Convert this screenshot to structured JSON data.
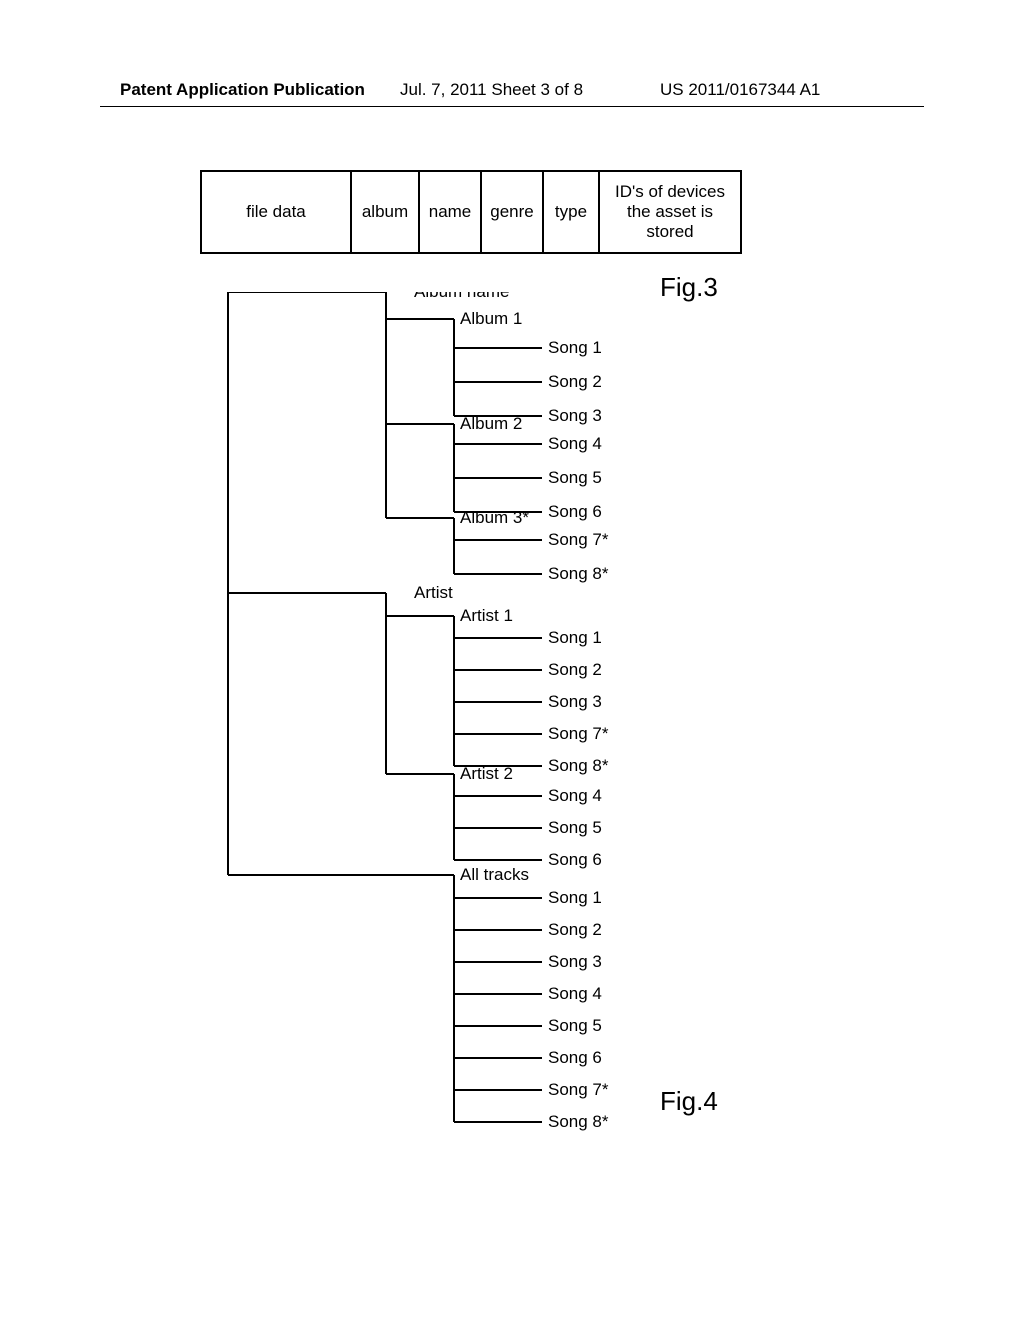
{
  "header": {
    "left": "Patent Application Publication",
    "mid": "Jul. 7, 2011   Sheet 3 of 8",
    "right": "US 2011/0167344 A1"
  },
  "figs": {
    "f3": "Fig.3",
    "f4": "Fig.4"
  },
  "table": {
    "cols": [
      "file data",
      "album",
      "name",
      "genre",
      "type",
      "ID's of devices the asset is stored"
    ]
  },
  "tree": {
    "cats": [
      {
        "label": "Album name",
        "children": [
          {
            "label": "Album 1",
            "songs": [
              "Song 1",
              "Song 2",
              "Song 3"
            ]
          },
          {
            "label": "Album 2",
            "songs": [
              "Song 4",
              "Song 5",
              "Song 6"
            ]
          },
          {
            "label": "Album 3*",
            "songs": [
              "Song 7*",
              "Song 8*"
            ]
          }
        ]
      },
      {
        "label": "Artist",
        "children": [
          {
            "label": "Artist 1",
            "songs": [
              "Song 1",
              "Song 2",
              "Song 3",
              "Song 7*",
              "Song 8*"
            ]
          },
          {
            "label": "Artist 2",
            "songs": [
              "Song 4",
              "Song 5",
              "Song 6"
            ]
          }
        ]
      },
      {
        "label": "All tracks",
        "songs": [
          "Song 1",
          "Song 2",
          "Song 3",
          "Song 4",
          "Song 5",
          "Song 6",
          "Song 7*",
          "Song 8*"
        ]
      }
    ]
  }
}
